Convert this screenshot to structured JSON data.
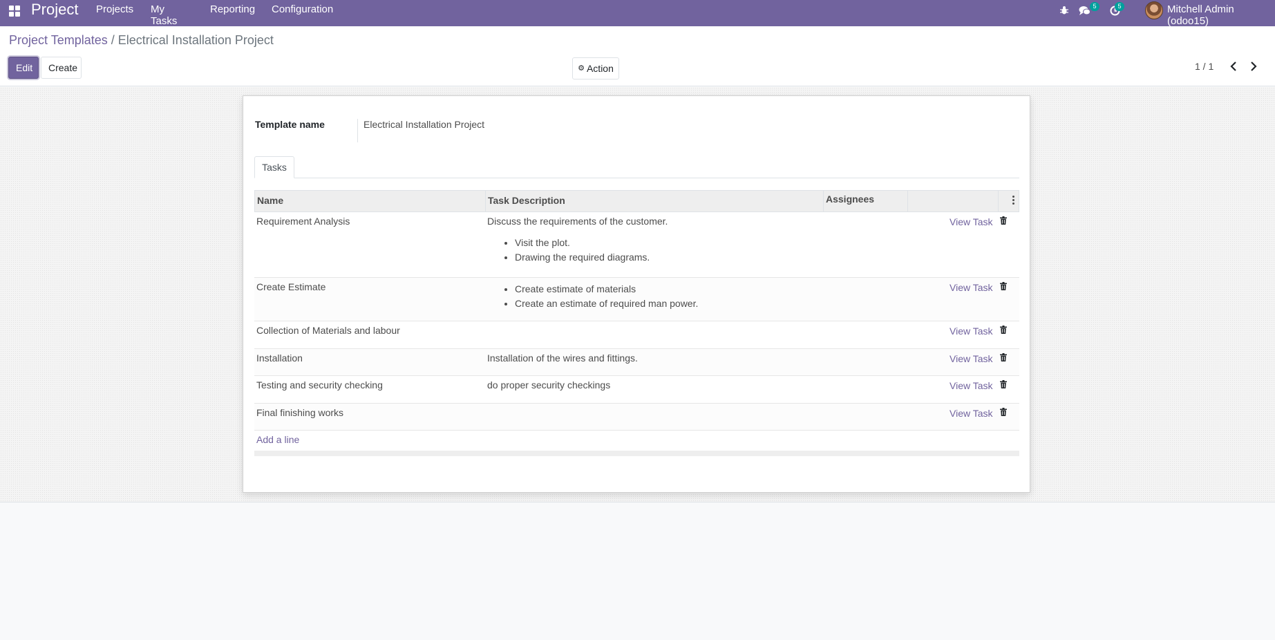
{
  "navbar": {
    "brand": "Project",
    "menu": [
      "Projects",
      "My Tasks",
      "Reporting",
      "Configuration"
    ],
    "messages_count": "5",
    "activities_count": "5",
    "user": "Mitchell Admin (odoo15)"
  },
  "breadcrumb": {
    "parent": "Project Templates",
    "separator": "/",
    "current": "Electrical Installation Project"
  },
  "buttons": {
    "edit": "Edit",
    "create": "Create",
    "action": "Action"
  },
  "pager": {
    "value": "1 / 1"
  },
  "form": {
    "template_label": "Template name",
    "template_value": "Electrical Installation Project",
    "tab": "Tasks"
  },
  "table": {
    "headers": [
      "Name",
      "Task Description",
      "Assignees"
    ],
    "rows": [
      {
        "name": "Requirement Analysis",
        "desc": "Discuss the requirements of the customer.",
        "bullets": [
          "Visit the plot.",
          "Drawing the required diagrams."
        ],
        "action": "View Task"
      },
      {
        "name": "Create Estimate",
        "desc": "",
        "bullets": [
          "Create estimate of materials",
          "Create an estimate of required man power."
        ],
        "action": "View Task"
      },
      {
        "name": "Collection of Materials and labour",
        "desc": "",
        "action": "View Task"
      },
      {
        "name": "Installation",
        "desc": "Installation of the wires and fittings.",
        "action": "View Task"
      },
      {
        "name": "Testing and security checking",
        "desc": "do proper security checkings",
        "action": "View Task"
      },
      {
        "name": "Final finishing works",
        "desc": "",
        "action": "View Task"
      }
    ],
    "add_line": "Add a line"
  },
  "colors": {
    "primary": "#71639e",
    "badge": "#00a09d"
  }
}
